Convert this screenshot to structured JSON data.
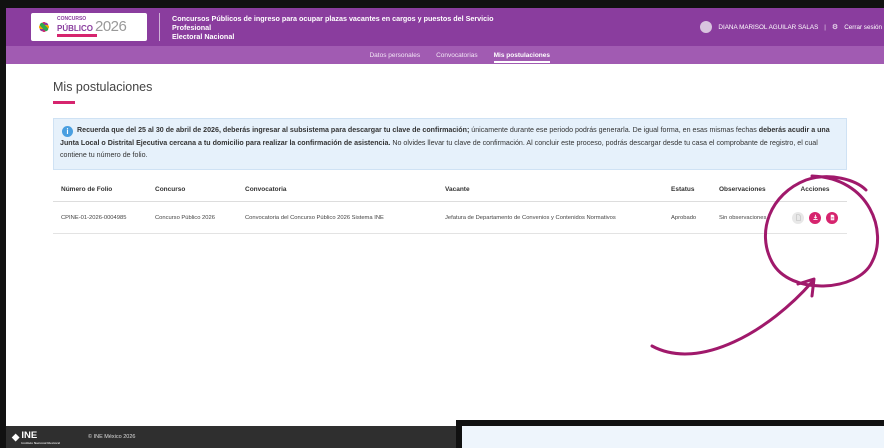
{
  "header": {
    "logo_top": "CONCURSO",
    "logo_main": "PÚBLICO",
    "logo_year": "2026",
    "title_line1": "Concursos Públicos de ingreso para ocupar plazas vacantes en cargos  y puestos del Servicio Profesional",
    "title_line2": "Electoral Nacional",
    "user_name": "DIANA MARISOL AGUILAR SALAS",
    "separator": "|",
    "logout": "Cerrar sesión"
  },
  "nav": {
    "items": [
      "Datos personales",
      "Convocatorias",
      "Mis postulaciones"
    ]
  },
  "page": {
    "title": "Mis postulaciones"
  },
  "alert": {
    "part1": "Recuerda que del 25 al 30  de abril de 2026, deberás ingresar al subsistema para descargar tu clave de confirmación;",
    "part2": " únicamente durante ese periodo podrás generarla. De igual forma, en esas mismas fechas ",
    "part3": "deberás acudir a una Junta Local o Distrital Ejecutiva cercana a tu domicilio para realizar la confirmación de asistencia.",
    "part4": " No olvides llevar tu clave de confirmación. Al concluir este proceso, podrás descargar desde tu casa el comprobante de registro, el cual contiene tu número de folio."
  },
  "table": {
    "headers": [
      "Número de Folio",
      "Concurso",
      "Convocatoria",
      "Vacante",
      "Estatus",
      "Observaciones",
      "Acciones"
    ],
    "rows": [
      {
        "folio": "CPINE-01-2026-0004985",
        "concurso": "Concurso Público 2026",
        "convocatoria": "Convocatoria del Concurso Público 2026 Sistema INE",
        "vacante": "Jefatura de Departamento de Convenios y Contenidos Normativos",
        "estatus": "Aprobado",
        "observaciones": "Sin observaciones"
      }
    ]
  },
  "footer": {
    "brand": "INE",
    "brand_sub": "Instituto Nacional Electoral",
    "copyright": "© INE México 2026"
  },
  "colors": {
    "header": "#8a3d9e",
    "nav": "#a15bb2",
    "accent": "#d6246e",
    "alert_bg": "#e6f1fb",
    "footer": "#2f2f2f"
  },
  "icons": [
    "info-icon",
    "file-icon",
    "download-icon",
    "pdf-icon",
    "gear-icon",
    "user-avatar"
  ]
}
